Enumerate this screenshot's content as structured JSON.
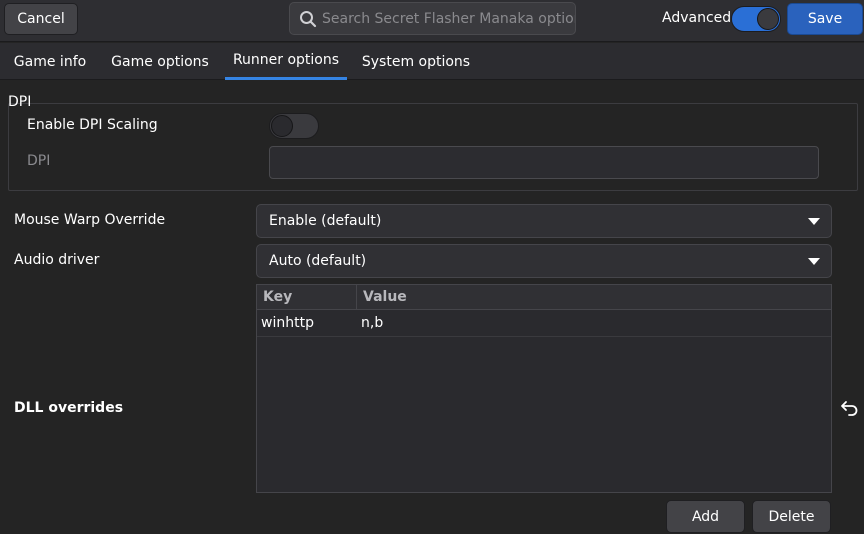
{
  "header": {
    "cancel_label": "Cancel",
    "search_placeholder": "Search Secret Flasher Manaka options",
    "advanced_label": "Advanced",
    "advanced_on": true,
    "save_label": "Save"
  },
  "tabs": [
    {
      "label": "Game info",
      "active": false
    },
    {
      "label": "Game options",
      "active": false
    },
    {
      "label": "Runner options",
      "active": true
    },
    {
      "label": "System options",
      "active": false
    }
  ],
  "dpi": {
    "frame_label": "DPI",
    "enable_label": "Enable DPI Scaling",
    "enable_on": false,
    "dpi_label": "DPI",
    "dpi_value": ""
  },
  "mouse_warp": {
    "label": "Mouse Warp Override",
    "selected": "Enable (default)"
  },
  "audio_driver": {
    "label": "Audio driver",
    "selected": "Auto (default)"
  },
  "dll_overrides": {
    "label": "DLL overrides",
    "columns": [
      "Key",
      "Value"
    ],
    "rows": [
      {
        "key": "winhttp",
        "value": "n,b"
      }
    ],
    "add_label": "Add",
    "delete_label": "Delete"
  },
  "colors": {
    "accent": "#3584e4",
    "save_bg": "#2a62bd",
    "background": "#242424"
  }
}
